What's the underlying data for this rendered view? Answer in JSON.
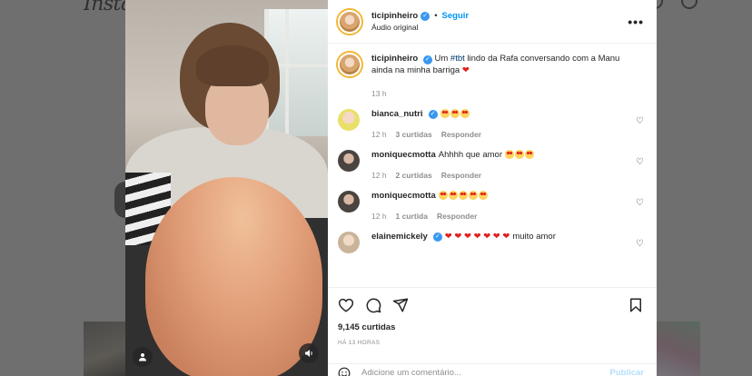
{
  "background": {
    "logo": "Instagram"
  },
  "post": {
    "username": "ticipinheiro",
    "dot": "•",
    "follow_label": "Seguir",
    "audio": "Áudio original",
    "caption_prefix": "Um ",
    "caption_hashtag": "#tbt",
    "caption_suffix": " lindo da Rafa conversando com a Manu ainda na minha barriga ",
    "caption_time": "13 h",
    "likes": "9,145 curtidas",
    "date": "HÁ 13 HORAS",
    "comment_placeholder": "Adicione um comentário...",
    "publish_label": "Publicar"
  },
  "comments": [
    {
      "username": "bianca_nutri",
      "verified": true,
      "text": "",
      "emoji_count": 3,
      "time": "12 h",
      "likes": "3 curtidas",
      "reply": "Responder",
      "avatar_color": "#e9e06a"
    },
    {
      "username": "moniquecmotta",
      "verified": false,
      "text": "Ahhhh que amor ",
      "emoji_count": 3,
      "time": "12 h",
      "likes": "2 curtidas",
      "reply": "Responder",
      "avatar_color": "#4a4440"
    },
    {
      "username": "moniquecmotta",
      "verified": false,
      "text": "",
      "emoji_count": 5,
      "time": "12 h",
      "likes": "1 curtida",
      "reply": "Responder",
      "avatar_color": "#4a4440"
    },
    {
      "username": "elainemickely",
      "verified": true,
      "text": " muito amor",
      "hearts": "❤ ❤ ❤ ❤ ❤ ❤ ❤",
      "avatar_color": "#c9b49a"
    }
  ],
  "icons": {
    "heart": "heart-icon",
    "comment": "comment-icon",
    "share": "share-icon",
    "save": "bookmark-icon",
    "more": "more-options-icon",
    "emoji": "emoji-icon",
    "user_tag": "user-tag-icon",
    "audio": "speaker-icon"
  },
  "colors": {
    "verified": "#3897f0",
    "follow": "#0095f6",
    "heart": "#e0211f"
  }
}
